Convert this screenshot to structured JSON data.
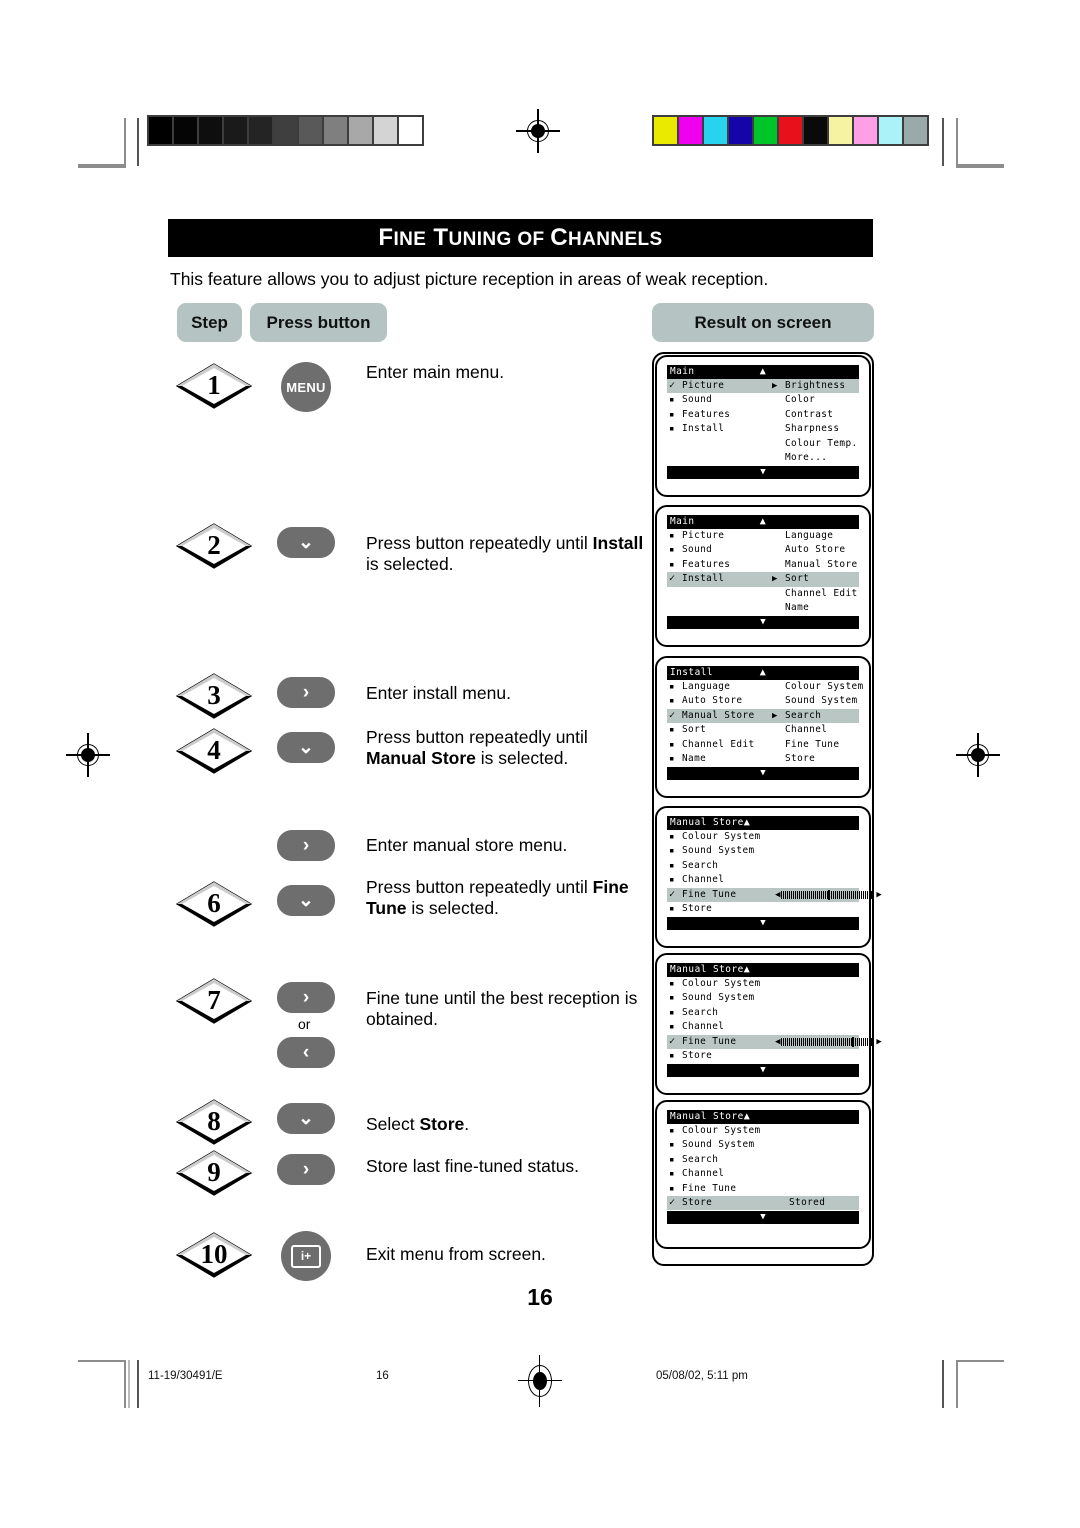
{
  "document": {
    "title": "Fine Tuning of Channels",
    "title_parts": [
      "F",
      "INE",
      " T",
      "UNING",
      " OF ",
      "C",
      "HANNELS"
    ],
    "intro": "This feature allows you to adjust picture reception in areas of weak reception.",
    "page_number": "16"
  },
  "table_headers": {
    "step": "Step",
    "press_button": "Press button",
    "result": "Result on screen"
  },
  "steps": [
    {
      "number": "1",
      "button": "MENU",
      "button_kind": "circle-menu",
      "text_before": "Enter main menu.",
      "bold": "",
      "text_after": ""
    },
    {
      "number": "2",
      "button": "⌄",
      "button_kind": "pill-down",
      "text_before": "Press button repeatedly until ",
      "bold": "Install",
      "text_after": " is selected."
    },
    {
      "number": "3",
      "button": "›",
      "button_kind": "pill-right",
      "text_before": "Enter install menu.",
      "bold": "",
      "text_after": ""
    },
    {
      "number": "4",
      "button": "⌄",
      "button_kind": "pill-down",
      "text_before": "Press button repeatedly until ",
      "bold": "Manual Store",
      "text_after": " is selected."
    },
    {
      "number": "",
      "button": "›",
      "button_kind": "pill-right",
      "text_before": "Enter manual store menu.",
      "bold": "",
      "text_after": ""
    },
    {
      "number": "6",
      "button": "⌄",
      "button_kind": "pill-down",
      "text_before": "Press button repeatedly until ",
      "bold": "Fine Tune",
      "text_after": " is selected."
    },
    {
      "number": "7",
      "button": "›",
      "button_kind": "pill-right-or-left",
      "or_label": "or",
      "text_before": "Fine tune until the best reception is obtained.",
      "bold": "",
      "text_after": ""
    },
    {
      "number": "8",
      "button": "⌄",
      "button_kind": "pill-down",
      "text_before": "Select ",
      "bold": "Store",
      "text_after": "."
    },
    {
      "number": "9",
      "button": "›",
      "button_kind": "pill-right",
      "text_before": "Store last fine-tuned status.",
      "bold": "",
      "text_after": ""
    },
    {
      "number": "10",
      "button": "i+",
      "button_kind": "circle-info",
      "text_before": "Exit menu from screen.",
      "bold": "",
      "text_after": ""
    }
  ],
  "screens": [
    {
      "title": "Main",
      "title_arrow": "▲",
      "rows": [
        {
          "mark": "check",
          "label": "Picture",
          "arrow": "▶",
          "right": "Brightness",
          "highlight": true
        },
        {
          "mark": "sq",
          "label": "Sound",
          "arrow": "",
          "right": "Color",
          "highlight": false
        },
        {
          "mark": "sq",
          "label": "Features",
          "arrow": "",
          "right": "Contrast",
          "highlight": false
        },
        {
          "mark": "sq",
          "label": "Install",
          "arrow": "",
          "right": "Sharpness",
          "highlight": false
        },
        {
          "mark": "",
          "label": "",
          "arrow": "",
          "right": "Colour Temp.",
          "highlight": false
        },
        {
          "mark": "",
          "label": "",
          "arrow": "",
          "right": "More...",
          "highlight": false
        }
      ],
      "bottom_arrow": "▼"
    },
    {
      "title": "Main",
      "title_arrow": "▲",
      "rows": [
        {
          "mark": "sq",
          "label": "Picture",
          "arrow": "",
          "right": "Language",
          "highlight": false
        },
        {
          "mark": "sq",
          "label": "Sound",
          "arrow": "",
          "right": "Auto Store",
          "highlight": false
        },
        {
          "mark": "sq",
          "label": "Features",
          "arrow": "",
          "right": "Manual Store",
          "highlight": false
        },
        {
          "mark": "check",
          "label": "Install",
          "arrow": "▶",
          "right": "Sort",
          "highlight": true
        },
        {
          "mark": "",
          "label": "",
          "arrow": "",
          "right": "Channel Edit",
          "highlight": false
        },
        {
          "mark": "",
          "label": "",
          "arrow": "",
          "right": "Name",
          "highlight": false
        }
      ],
      "bottom_arrow": "▼"
    },
    {
      "title": "Install",
      "title_arrow": "▲",
      "rows": [
        {
          "mark": "sq",
          "label": "Language",
          "arrow": "",
          "right": "Colour System",
          "highlight": false
        },
        {
          "mark": "sq",
          "label": "Auto Store",
          "arrow": "",
          "right": "Sound System",
          "highlight": false
        },
        {
          "mark": "check",
          "label": "Manual Store",
          "arrow": "▶",
          "right": "Search",
          "highlight": true
        },
        {
          "mark": "sq",
          "label": "Sort",
          "arrow": "",
          "right": "Channel",
          "highlight": false
        },
        {
          "mark": "sq",
          "label": "Channel Edit",
          "arrow": "",
          "right": "Fine Tune",
          "highlight": false
        },
        {
          "mark": "sq",
          "label": "Name",
          "arrow": "",
          "right": "Store",
          "highlight": false
        }
      ],
      "bottom_arrow": "▼"
    },
    {
      "title": "Manual Store",
      "title_arrow": "▲",
      "rows": [
        {
          "mark": "sq",
          "label": "Colour System",
          "arrow": "",
          "right": "",
          "highlight": false
        },
        {
          "mark": "sq",
          "label": "Sound System",
          "arrow": "",
          "right": "",
          "highlight": false
        },
        {
          "mark": "sq",
          "label": "Search",
          "arrow": "",
          "right": "",
          "highlight": false
        },
        {
          "mark": "sq",
          "label": "Channel",
          "arrow": "",
          "right": "",
          "highlight": false
        },
        {
          "mark": "check",
          "label": "Fine Tune",
          "arrow": "",
          "right": "",
          "highlight": true,
          "slider": 50
        },
        {
          "mark": "sq",
          "label": "Store",
          "arrow": "",
          "right": "",
          "highlight": false
        }
      ],
      "bottom_arrow": "▼"
    },
    {
      "title": "Manual Store",
      "title_arrow": "▲",
      "rows": [
        {
          "mark": "sq",
          "label": "Colour System",
          "arrow": "",
          "right": "",
          "highlight": false
        },
        {
          "mark": "sq",
          "label": "Sound System",
          "arrow": "",
          "right": "",
          "highlight": false
        },
        {
          "mark": "sq",
          "label": "Search",
          "arrow": "",
          "right": "",
          "highlight": false
        },
        {
          "mark": "sq",
          "label": "Channel",
          "arrow": "",
          "right": "",
          "highlight": false
        },
        {
          "mark": "check",
          "label": "Fine Tune",
          "arrow": "",
          "right": "",
          "highlight": true,
          "slider": 76
        },
        {
          "mark": "sq",
          "label": "Store",
          "arrow": "",
          "right": "",
          "highlight": false
        }
      ],
      "bottom_arrow": "▼"
    },
    {
      "title": "Manual Store",
      "title_arrow": "▲",
      "rows": [
        {
          "mark": "sq",
          "label": "Colour System",
          "arrow": "",
          "right": "",
          "highlight": false
        },
        {
          "mark": "sq",
          "label": "Sound System",
          "arrow": "",
          "right": "",
          "highlight": false
        },
        {
          "mark": "sq",
          "label": "Search",
          "arrow": "",
          "right": "",
          "highlight": false
        },
        {
          "mark": "sq",
          "label": "Channel",
          "arrow": "",
          "right": "",
          "highlight": false
        },
        {
          "mark": "sq",
          "label": "Fine Tune",
          "arrow": "",
          "right": "",
          "highlight": false
        },
        {
          "mark": "check",
          "label": "Store",
          "arrow": "",
          "right": "Stored",
          "highlight": true
        }
      ],
      "bottom_arrow": "▼"
    }
  ],
  "print_marks": {
    "grayscale_swatches": [
      "#000000",
      "#050505",
      "#0e0e0e",
      "#1a1a1a",
      "#242424",
      "#3f3f3f",
      "#595959",
      "#7f7f7f",
      "#a8a8a8",
      "#d4d4d4",
      "#ffffff"
    ],
    "color_swatches": [
      "#eaea00",
      "#ee00ee",
      "#27d3ef",
      "#1505a8",
      "#00c52a",
      "#e8101b",
      "#0a0a0a",
      "#f6f3a3",
      "#ffa0e6",
      "#aaf2f7",
      "#9aa9a9"
    ]
  },
  "footer": {
    "job_code": "11-19/30491/E",
    "page": "16",
    "timestamp": "05/08/02, 5:11 pm"
  }
}
